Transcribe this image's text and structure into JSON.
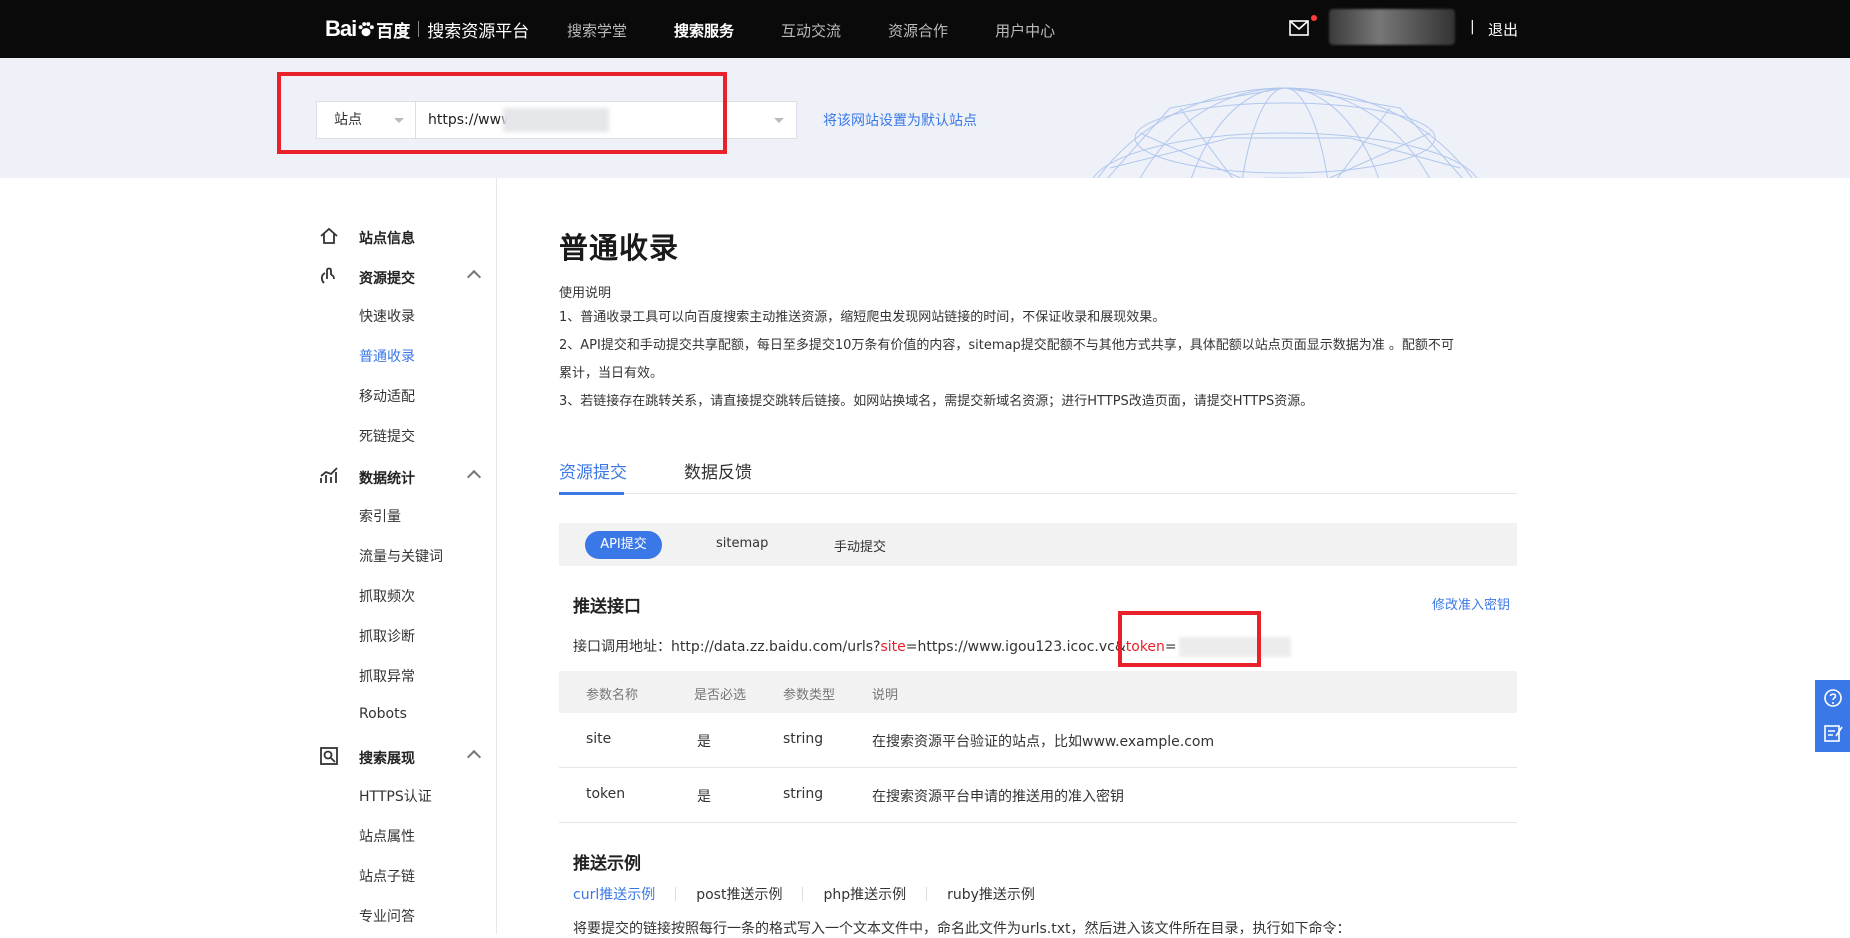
{
  "brand": {
    "logo_bai": "Bai",
    "logo_baidu": "百度",
    "platform": "搜索资源平台"
  },
  "nav": [
    "搜索学堂",
    "搜索服务",
    "互动交流",
    "资源合作",
    "用户中心"
  ],
  "nav_active_index": 1,
  "header": {
    "separator": "|",
    "logout": "退出"
  },
  "site_bar": {
    "selector_label": "站点",
    "url_value": "https://www",
    "set_default": "将该网站设置为默认站点"
  },
  "sidebar": {
    "sections": [
      {
        "label": "站点信息",
        "icon": "home-icon",
        "items": []
      },
      {
        "label": "资源提交",
        "icon": "submit-icon",
        "items": [
          "快速收录",
          "普通收录",
          "移动适配",
          "死链提交"
        ]
      },
      {
        "label": "数据统计",
        "icon": "stats-icon",
        "items": [
          "索引量",
          "流量与关键词",
          "抓取频次",
          "抓取诊断",
          "抓取异常",
          "Robots"
        ]
      },
      {
        "label": "搜索展现",
        "icon": "search-display-icon",
        "items": [
          "HTTPS认证",
          "站点属性",
          "站点子链",
          "专业问答"
        ]
      }
    ],
    "active_item": "普通收录"
  },
  "page": {
    "title": "普通收录",
    "usage_title": "使用说明",
    "desc_lines": [
      "1、普通收录工具可以向百度搜索主动推送资源，缩短爬虫发现网站链接的时间，不保证收录和展现效果。",
      "2、API提交和手动提交共享配额，每日至多提交10万条有价值的内容，sitemap提交配额不与其他方式共享，具体配额以站点页面显示数据为准 。配额不可",
      "累计，当日有效。",
      "3、若链接存在跳转关系，请直接提交跳转后链接。如网站换域名，需提交新域名资源；进行HTTPS改造页面，请提交HTTPS资源。"
    ],
    "tabs": [
      "资源提交",
      "数据反馈"
    ],
    "subtabs": [
      "API提交",
      "sitemap",
      "手动提交"
    ],
    "push_api": {
      "title": "推送接口",
      "edit_key": "修改准入密钥",
      "url_prefix": "接口调用地址：http://data.zz.baidu.com/urls?",
      "site_key": "site",
      "site_value": "=https://www.igou123.icoc.vc&",
      "token_key": "token",
      "token_eq": "="
    },
    "params_table": {
      "headers": [
        "参数名称",
        "是否必选",
        "参数类型",
        "说明"
      ],
      "rows": [
        [
          "site",
          "是",
          "string",
          "在搜索资源平台验证的站点，比如www.example.com"
        ],
        [
          "token",
          "是",
          "string",
          "在搜索资源平台申请的推送用的准入密钥"
        ]
      ]
    },
    "examples": {
      "title": "推送示例",
      "tabs": [
        "curl推送示例",
        "post推送示例",
        "php推送示例",
        "ruby推送示例"
      ],
      "cut_text": "将要提交的链接按照每行一条的格式写入一个文本文件中，命名此文件为urls.txt，然后进入该文件所在目录，执行如下命令："
    }
  },
  "colors": {
    "accent": "#3b78e7",
    "highlight": "#e8212a",
    "topbar": "#0a0a0a"
  }
}
